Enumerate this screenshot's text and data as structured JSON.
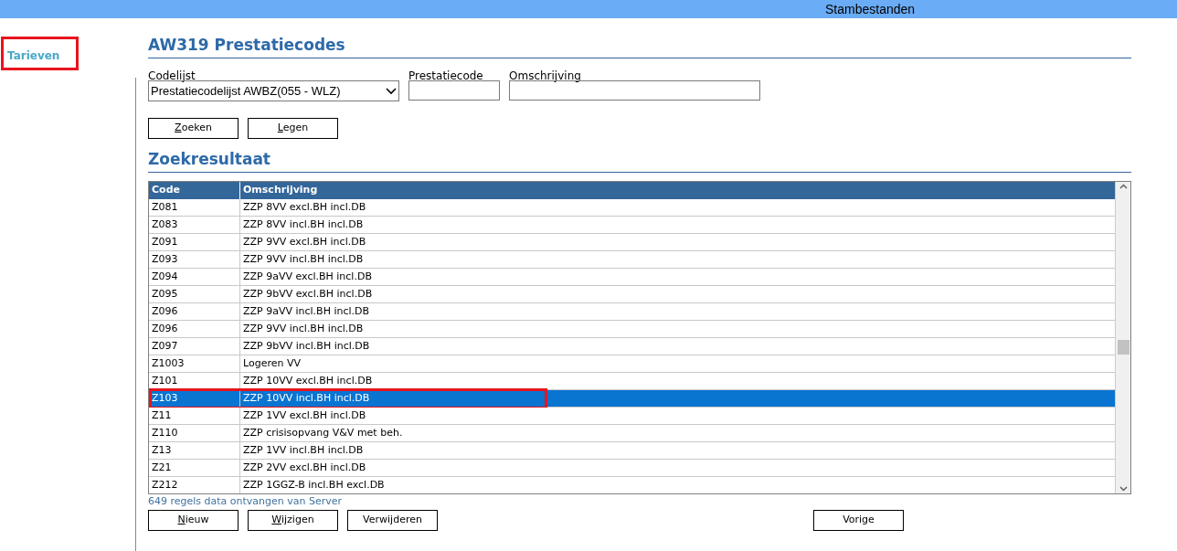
{
  "top_bar": {
    "title": "Stambestanden"
  },
  "sidebar": {
    "items": [
      {
        "label": "Tarieven",
        "annotated": true
      }
    ]
  },
  "page": {
    "title": "AW319 Prestatiecodes"
  },
  "filters": {
    "codelijst": {
      "label": "Codelijst",
      "value": "Prestatiecodelijst AWBZ(055 - WLZ)"
    },
    "prestatiecode": {
      "label": "Prestatiecode"
    },
    "omschrijving": {
      "label": "Omschrijving"
    }
  },
  "search_buttons": [
    {
      "label": "Zoeken",
      "mnemonic": true
    },
    {
      "label": "Legen",
      "mnemonic": true
    }
  ],
  "results": {
    "title": "Zoekresultaat",
    "columns": [
      "Code",
      "Omschrijving"
    ],
    "rows": [
      {
        "code": "Z081",
        "omschrijving": "ZZP 8VV excl.BH incl.DB",
        "selected": false,
        "annotated": false
      },
      {
        "code": "Z083",
        "omschrijving": "ZZP 8VV incl.BH incl.DB",
        "selected": false,
        "annotated": false
      },
      {
        "code": "Z091",
        "omschrijving": "ZZP 9VV excl.BH incl.DB",
        "selected": false,
        "annotated": false
      },
      {
        "code": "Z093",
        "omschrijving": "ZZP 9VV incl.BH incl.DB",
        "selected": false,
        "annotated": false
      },
      {
        "code": "Z094",
        "omschrijving": "ZZP 9aVV excl.BH incl.DB",
        "selected": false,
        "annotated": false
      },
      {
        "code": "Z095",
        "omschrijving": "ZZP 9bVV excl.BH incl.DB",
        "selected": false,
        "annotated": false
      },
      {
        "code": "Z096",
        "omschrijving": "ZZP 9aVV incl.BH incl.DB",
        "selected": false,
        "annotated": false
      },
      {
        "code": "Z096",
        "omschrijving": "ZZP 9VV incl.BH incl.DB",
        "selected": false,
        "annotated": false
      },
      {
        "code": "Z097",
        "omschrijving": "ZZP 9bVV incl.BH incl.DB",
        "selected": false,
        "annotated": false
      },
      {
        "code": "Z1003",
        "omschrijving": "Logeren VV",
        "selected": false,
        "annotated": false
      },
      {
        "code": "Z101",
        "omschrijving": "ZZP 10VV excl.BH incl.DB",
        "selected": false,
        "annotated": false
      },
      {
        "code": "Z103",
        "omschrijving": "ZZP 10VV incl.BH incl.DB",
        "selected": true,
        "annotated": true
      },
      {
        "code": "Z11",
        "omschrijving": "ZZP 1VV excl.BH incl.DB",
        "selected": false,
        "annotated": false
      },
      {
        "code": "Z110",
        "omschrijving": "ZZP crisisopvang V&V met beh.",
        "selected": false,
        "annotated": false
      },
      {
        "code": "Z13",
        "omschrijving": "ZZP 1VV incl.BH incl.DB",
        "selected": false,
        "annotated": false
      },
      {
        "code": "Z21",
        "omschrijving": "ZZP 2VV excl.BH incl.DB",
        "selected": false,
        "annotated": false
      },
      {
        "code": "Z212",
        "omschrijving": "ZZP 1GGZ-B incl.BH excl.DB",
        "selected": false,
        "annotated": false
      }
    ],
    "status": "649 regels data ontvangen van Server"
  },
  "action_buttons": [
    {
      "label": "Nieuw",
      "mnemonic": true
    },
    {
      "label": "Wijzigen",
      "mnemonic": true
    },
    {
      "label": "Verwijderen",
      "mnemonic": false
    }
  ],
  "nav_buttons": [
    {
      "label": "Vorige",
      "mnemonic": false
    }
  ]
}
